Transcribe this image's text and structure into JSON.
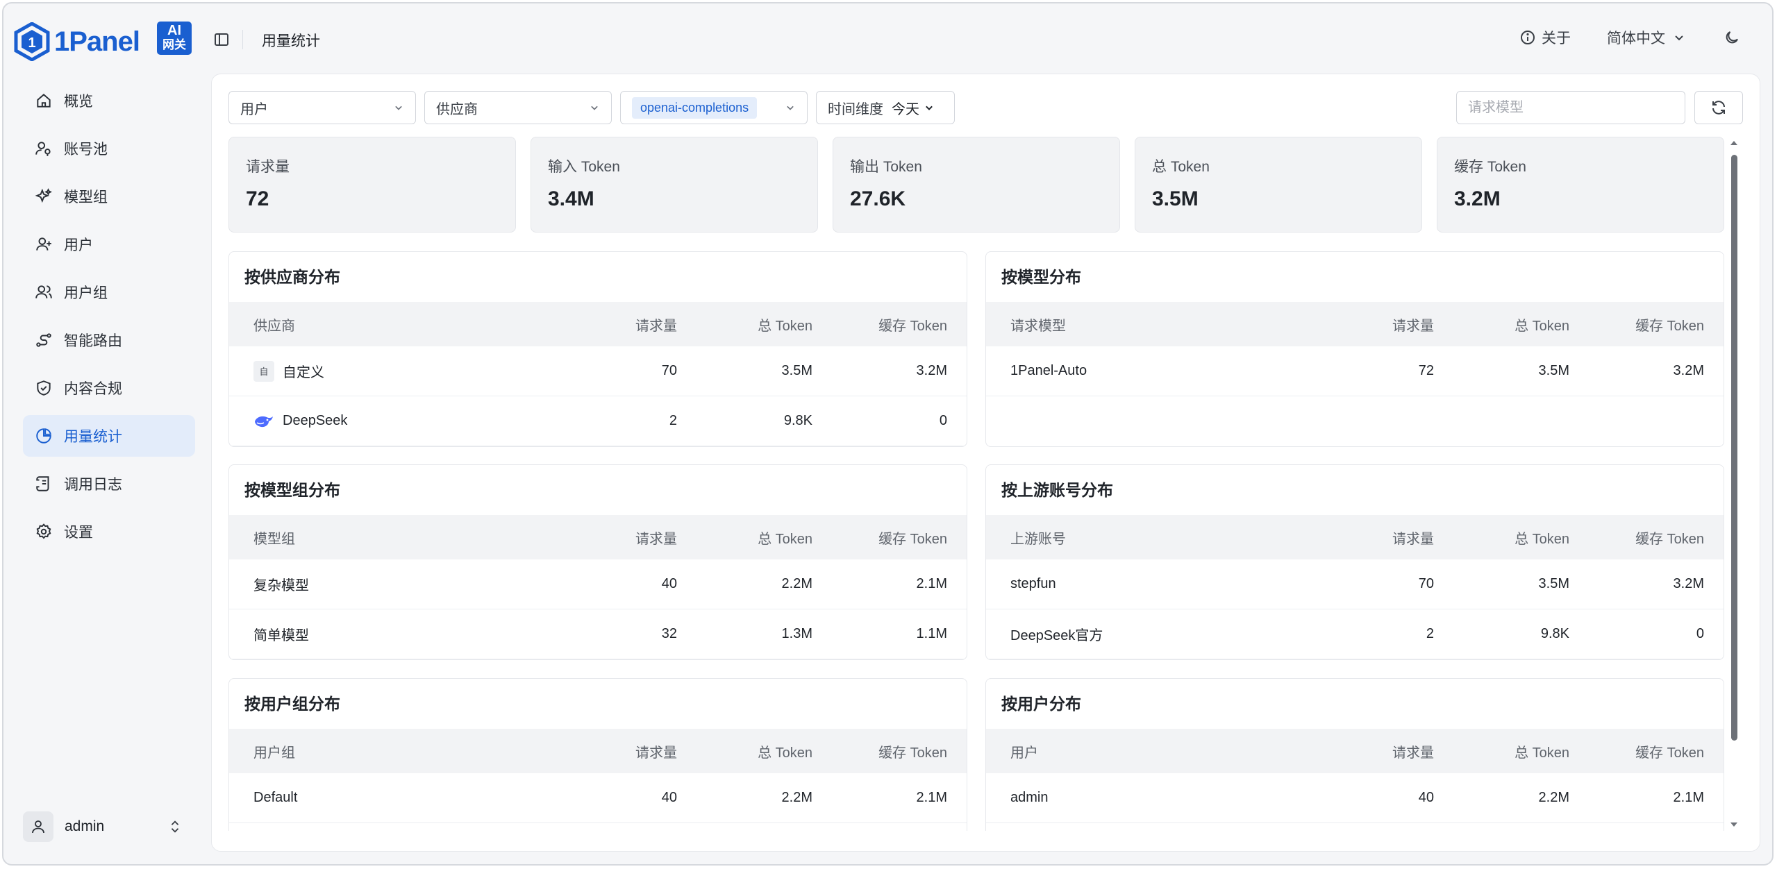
{
  "brand": {
    "name": "1Panel",
    "badge_line1": "AI",
    "badge_line2": "网关"
  },
  "header": {
    "title": "用量统计",
    "about_label": "关于",
    "language_label": "简体中文"
  },
  "sidebar": {
    "items": [
      {
        "label": "概览"
      },
      {
        "label": "账号池"
      },
      {
        "label": "模型组"
      },
      {
        "label": "用户"
      },
      {
        "label": "用户组"
      },
      {
        "label": "智能路由"
      },
      {
        "label": "内容合规"
      },
      {
        "label": "用量统计",
        "active": true
      },
      {
        "label": "调用日志"
      },
      {
        "label": "设置"
      }
    ],
    "user": {
      "name": "admin"
    }
  },
  "filters": {
    "user_label": "用户",
    "provider_label": "供应商",
    "api_tag": "openai-completions",
    "time_dimension_label": "时间维度",
    "time_dimension_value": "今天",
    "model_placeholder": "请求模型"
  },
  "stats": [
    {
      "label": "请求量",
      "value": "72"
    },
    {
      "label": "输入 Token",
      "value": "3.4M"
    },
    {
      "label": "输出 Token",
      "value": "27.6K"
    },
    {
      "label": "总 Token",
      "value": "3.5M"
    },
    {
      "label": "缓存 Token",
      "value": "3.2M"
    }
  ],
  "common_columns": {
    "requests": "请求量",
    "total_token": "总 Token",
    "cache_token": "缓存 Token"
  },
  "panels": {
    "provider": {
      "title": "按供应商分布",
      "first_col": "供应商",
      "rows": [
        {
          "name": "自定义",
          "icon_text": "自",
          "requests": "70",
          "total": "3.5M",
          "cache": "3.2M"
        },
        {
          "name": "DeepSeek",
          "requests": "2",
          "total": "9.8K",
          "cache": "0"
        }
      ]
    },
    "model": {
      "title": "按模型分布",
      "first_col": "请求模型",
      "rows": [
        {
          "name": "1Panel-Auto",
          "requests": "72",
          "total": "3.5M",
          "cache": "3.2M"
        }
      ]
    },
    "model_group": {
      "title": "按模型组分布",
      "first_col": "模型组",
      "rows": [
        {
          "name": "复杂模型",
          "requests": "40",
          "total": "2.2M",
          "cache": "2.1M"
        },
        {
          "name": "简单模型",
          "requests": "32",
          "total": "1.3M",
          "cache": "1.1M"
        }
      ]
    },
    "upstream": {
      "title": "按上游账号分布",
      "first_col": "上游账号",
      "rows": [
        {
          "name": "stepfun",
          "requests": "70",
          "total": "3.5M",
          "cache": "3.2M"
        },
        {
          "name": "DeepSeek官方",
          "requests": "2",
          "total": "9.8K",
          "cache": "0"
        }
      ]
    },
    "user_group": {
      "title": "按用户组分布",
      "first_col": "用户组",
      "rows": [
        {
          "name": "Default",
          "requests": "40",
          "total": "2.2M",
          "cache": "2.1M"
        }
      ]
    },
    "user": {
      "title": "按用户分布",
      "first_col": "用户",
      "rows": [
        {
          "name": "admin",
          "requests": "40",
          "total": "2.2M",
          "cache": "2.1M"
        }
      ]
    }
  },
  "colors": {
    "accent": "#1a5fd0",
    "active_nav_bg": "#e3ecfa",
    "card_bg": "#f2f3f5"
  }
}
